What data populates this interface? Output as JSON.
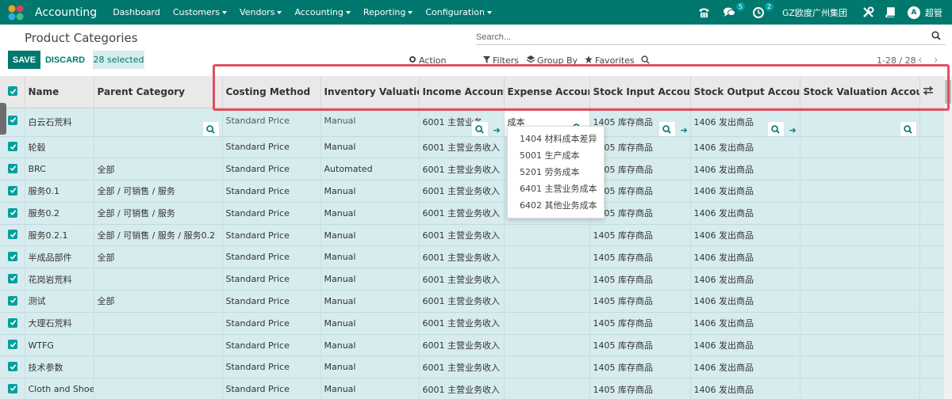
{
  "app": {
    "name": "Accounting",
    "menu": [
      "Dashboard",
      "Customers",
      "Vendors",
      "Accounting",
      "Reporting",
      "Configuration"
    ],
    "menu_has_caret": [
      false,
      true,
      true,
      true,
      true,
      true
    ],
    "chat_count": "5",
    "activity_count": "2",
    "company": "GZ欧度广州集团",
    "avatar_letter": "A",
    "user": "超管"
  },
  "control": {
    "title": "Product Categories",
    "search_placeholder": "Search...",
    "save_label": "SAVE",
    "discard_label": "DISCARD",
    "selected_label": "28 selected",
    "action_label": "Action",
    "filters_label": "Filters",
    "groupby_label": "Group By",
    "favorites_label": "Favorites",
    "pager": "1-28 / 28"
  },
  "table": {
    "headers": [
      "Name",
      "Parent Category",
      "Costing Method",
      "Inventory Valuation",
      "Income Account",
      "Expense Account",
      "Stock Input Account",
      "Stock Output Account",
      "Stock Valuation Account"
    ],
    "editing_row": {
      "name": "白云石荒料",
      "costing": "Standard Price",
      "valuation": "Manual",
      "income": "6001 主营业务",
      "expense_input": "成本",
      "stock_input": "1405 库存商品",
      "stock_output": "1406 发出商品"
    },
    "rows": [
      {
        "name": "轮毂",
        "parent": "",
        "costing": "Standard Price",
        "valuation": "Manual",
        "income": "6001 主营业务收入",
        "stock_input": "1405 库存商品",
        "stock_output": "1406 发出商品"
      },
      {
        "name": "BRC",
        "parent": "全部",
        "costing": "Standard Price",
        "valuation": "Automated",
        "income": "6001 主营业务收入",
        "stock_input": "1405 库存商品",
        "stock_output": "1406 发出商品"
      },
      {
        "name": "服务0.1",
        "parent": "全部 / 可销售 / 服务",
        "costing": "Standard Price",
        "valuation": "Manual",
        "income": "6001 主营业务收入",
        "stock_input": "1405 库存商品",
        "stock_output": "1406 发出商品"
      },
      {
        "name": "服务0.2",
        "parent": "全部 / 可销售 / 服务",
        "costing": "Standard Price",
        "valuation": "Manual",
        "income": "6001 主营业务收入",
        "stock_input": "1405 库存商品",
        "stock_output": "1406 发出商品"
      },
      {
        "name": "服务0.2.1",
        "parent": "全部 / 可销售 / 服务 / 服务0.2",
        "costing": "Standard Price",
        "valuation": "Manual",
        "income": "6001 主营业务收入",
        "stock_input": "1405 库存商品",
        "stock_output": "1406 发出商品"
      },
      {
        "name": "半成品部件",
        "parent": "全部",
        "costing": "Standard Price",
        "valuation": "Manual",
        "income": "6001 主营业务收入",
        "stock_input": "1405 库存商品",
        "stock_output": "1406 发出商品"
      },
      {
        "name": "花岗岩荒料",
        "parent": "",
        "costing": "Standard Price",
        "valuation": "Manual",
        "income": "6001 主营业务收入",
        "stock_input": "1405 库存商品",
        "stock_output": "1406 发出商品"
      },
      {
        "name": "测试",
        "parent": "全部",
        "costing": "Standard Price",
        "valuation": "Manual",
        "income": "6001 主营业务收入",
        "stock_input": "1405 库存商品",
        "stock_output": "1406 发出商品"
      },
      {
        "name": "大理石荒料",
        "parent": "",
        "costing": "Standard Price",
        "valuation": "Manual",
        "income": "6001 主营业务收入",
        "stock_input": "1405 库存商品",
        "stock_output": "1406 发出商品"
      },
      {
        "name": "WTFG",
        "parent": "",
        "costing": "Standard Price",
        "valuation": "Manual",
        "income": "6001 主营业务收入",
        "stock_input": "1405 库存商品",
        "stock_output": "1406 发出商品"
      },
      {
        "name": "技术参数",
        "parent": "",
        "costing": "Standard Price",
        "valuation": "Manual",
        "income": "6001 主营业务收入",
        "stock_input": "1405 库存商品",
        "stock_output": "1406 发出商品"
      },
      {
        "name": "Cloth and Shoe",
        "parent": "",
        "costing": "Standard Price",
        "valuation": "Manual",
        "income": "6001 主营业务收入",
        "stock_input": "1405 库存商品",
        "stock_output": "1406 发出商品"
      }
    ]
  },
  "dropdown": {
    "options": [
      "1404 材料成本差异",
      "5001 生产成本",
      "5201 劳务成本",
      "6401 主营业务成本",
      "6402 其他业务成本"
    ]
  },
  "colors": {
    "brand": "#00786e",
    "row_bg": "#d7ecef",
    "checkbox": "#00a09d",
    "highlight": "#e05060"
  }
}
